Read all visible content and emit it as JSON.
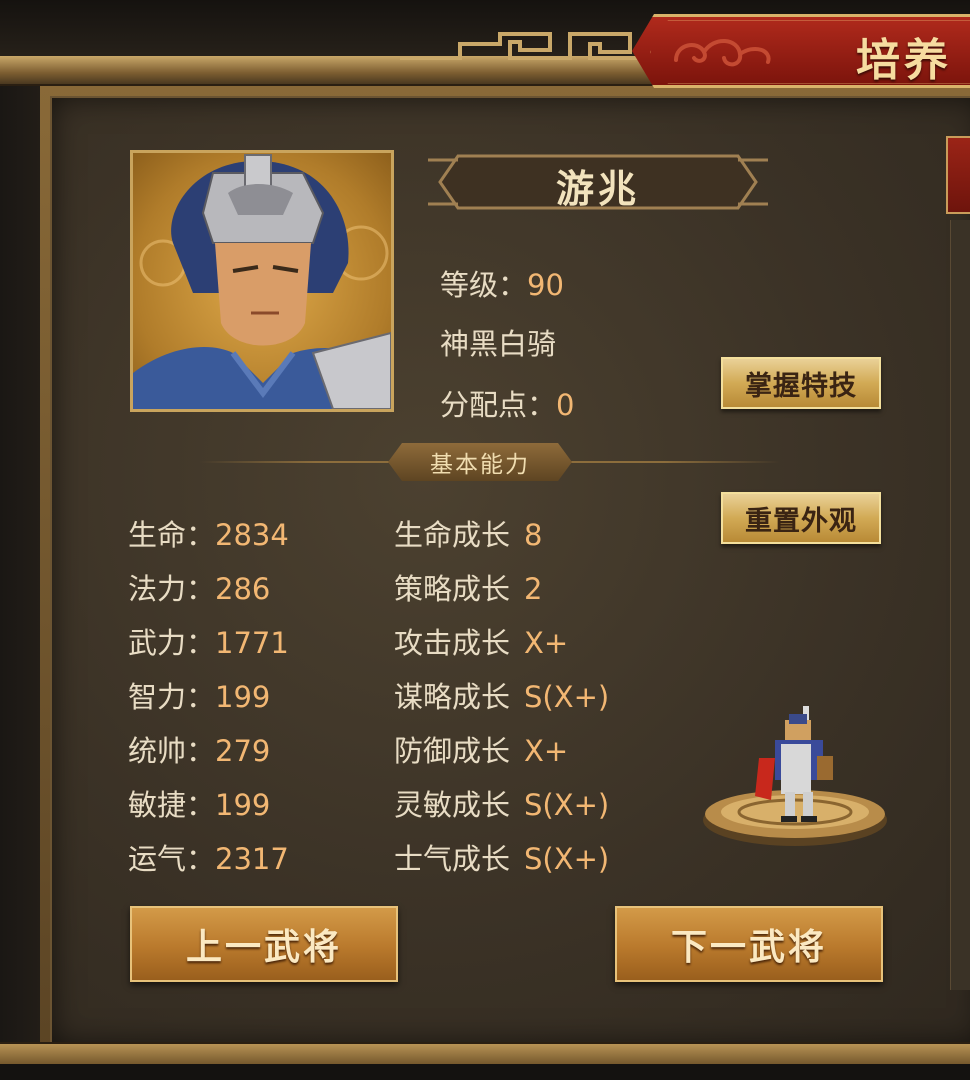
{
  "header": {
    "title": "培养"
  },
  "general": {
    "name": "游兆",
    "level_label": "等级：",
    "level_value": "90",
    "unit_type": "神黑白骑",
    "points_label": "分配点：",
    "points_value": "0"
  },
  "buttons": {
    "master_skill": "掌握特技",
    "reset_look": "重置外观",
    "prev_general": "上一武将",
    "next_general": "下一武将"
  },
  "section": {
    "basic_ability": "基本能力"
  },
  "stats": [
    {
      "label": "生命：",
      "value": "2834"
    },
    {
      "label": "法力：",
      "value": "286"
    },
    {
      "label": "武力：",
      "value": "1771"
    },
    {
      "label": "智力：",
      "value": "199"
    },
    {
      "label": "统帅：",
      "value": "279"
    },
    {
      "label": "敏捷：",
      "value": "199"
    },
    {
      "label": "运气：",
      "value": "2317"
    }
  ],
  "growth": [
    {
      "label": "生命成长",
      "value": "8"
    },
    {
      "label": "策略成长",
      "value": "2"
    },
    {
      "label": "攻击成长",
      "value": "X+"
    },
    {
      "label": "谋略成长",
      "value": "S(X+)"
    },
    {
      "label": "防御成长",
      "value": "X+"
    },
    {
      "label": "灵敏成长",
      "value": "S(X+)"
    },
    {
      "label": "士气成长",
      "value": "S(X+)"
    }
  ],
  "colors": {
    "accent_gold": "#f2b773",
    "banner_red": "#9e2418",
    "text_light": "#e8dcc4"
  }
}
